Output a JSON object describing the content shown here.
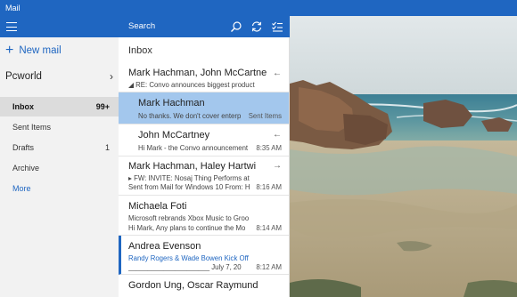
{
  "window": {
    "title": "Mail"
  },
  "nav": {
    "new_mail": "New mail",
    "account": "Pcworld",
    "folders": [
      {
        "label": "Inbox",
        "count": "99+"
      },
      {
        "label": "Sent Items",
        "count": ""
      },
      {
        "label": "Drafts",
        "count": "1"
      },
      {
        "label": "Archive",
        "count": ""
      }
    ],
    "more": "More"
  },
  "list": {
    "search_label": "Search",
    "folder_title": "Inbox",
    "messages": [
      {
        "sender": "Mark Hachman, John McCartne",
        "line2": "RE: Convo announces biggest product u",
        "line3": "",
        "time": "",
        "icon": "reply-icon"
      },
      {
        "sender": "Mark Hachman",
        "line2": "No thanks. We don't cover enterp",
        "line3": "",
        "time": "Sent Items",
        "icon": ""
      },
      {
        "sender": "John McCartney",
        "line2": "Hi Mark - the Convo announcement",
        "line3": "",
        "time": "8:35 AM",
        "icon": "reply-icon"
      },
      {
        "sender": "Mark Hachman, Haley Hartwi",
        "line2": "FW: INVITE: Nosaj Thing Performs at",
        "line3": "Sent from Mail for Windows 10 From: H",
        "time": "8:16 AM",
        "icon": "forward-icon"
      },
      {
        "sender": "Michaela Foti",
        "line2": "Microsoft rebrands Xbox Music to Groo",
        "line3": "Hi Mark, Any plans to continue the Mo",
        "time": "8:14 AM",
        "icon": ""
      },
      {
        "sender": "Andrea Evenson",
        "line2": "Randy Rogers & Wade Bowen Kick Off",
        "line3": "_____________________ July 7, 20",
        "time": "8:12 AM",
        "icon": ""
      },
      {
        "sender": "Gordon Ung, Oscar Raymund",
        "line2": "",
        "line3": "",
        "time": "",
        "icon": ""
      }
    ]
  }
}
